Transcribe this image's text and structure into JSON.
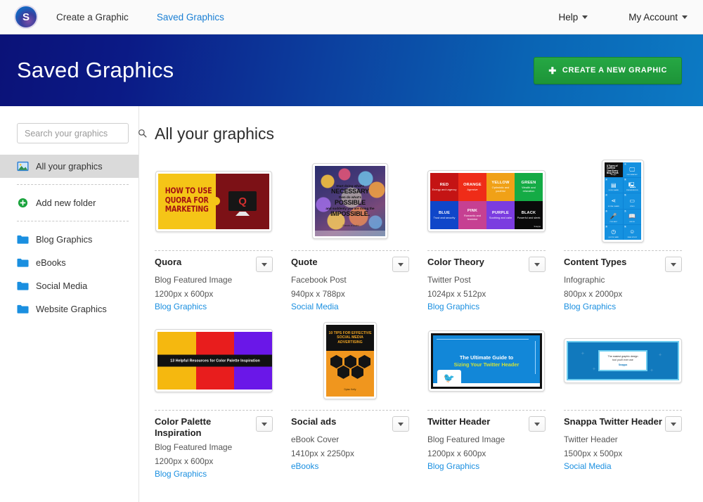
{
  "topnav": {
    "logo_letter": "S",
    "logo_icon": "snappa-logo-icon",
    "links": [
      {
        "label": "Create a Graphic",
        "active": false
      },
      {
        "label": "Saved Graphics",
        "active": true
      }
    ],
    "right_items": [
      {
        "label": "Help"
      },
      {
        "label": "My Account"
      }
    ]
  },
  "hero": {
    "title": "Saved Graphics",
    "button_label": "CREATE A NEW GRAPHIC",
    "button_plus": "✚",
    "button_color": "#1d9438",
    "gradient_from": "#0b1278",
    "gradient_to": "#0c7ac4"
  },
  "sidebar": {
    "search": {
      "placeholder": "Search your graphics",
      "value": "",
      "icon": "search-icon"
    },
    "all_graphics": {
      "label": "All your graphics",
      "icon": "image-icon",
      "selected": true
    },
    "add_folder": {
      "label": "Add new folder",
      "icon": "plus-circle-icon",
      "color": "#19a33c"
    },
    "folders": [
      {
        "label": "Blog Graphics",
        "icon": "folder-icon"
      },
      {
        "label": "eBooks",
        "icon": "folder-icon"
      },
      {
        "label": "Social Media",
        "icon": "folder-icon"
      },
      {
        "label": "Website Graphics",
        "icon": "folder-icon"
      }
    ],
    "folder_color": "#1a8fe0"
  },
  "main": {
    "title": "All your graphics",
    "link_color": "#1a8fe0",
    "cards": [
      {
        "title": "Quora",
        "type": "Blog Featured Image",
        "dimensions": "1200px x 600px",
        "folder": "Blog Graphics",
        "menu_icon": "chevron-down-icon",
        "art": {
          "headline": "HOW TO USE QUORA FOR MARKETING",
          "mark": "Q",
          "left_color": "#f5c517",
          "right_color": "#7c1116"
        }
      },
      {
        "title": "Quote",
        "type": "Facebook Post",
        "dimensions": "940px x 788px",
        "folder": "Social Media",
        "menu_icon": "chevron-down-icon",
        "art": {
          "line1": "Start doing what's",
          "line2": "NECESSARY",
          "line3": "then do what's",
          "line4": "POSSIBLE",
          "line5": "and suddenly you are doing the",
          "line6": "IMPOSSIBLE.",
          "credit": "- Francis of Assisi"
        }
      },
      {
        "title": "Color Theory",
        "type": "Twitter Post",
        "dimensions": "1024px x 512px",
        "folder": "Blog Graphics",
        "menu_icon": "chevron-down-icon",
        "art": {
          "badge": "Snappa",
          "swatches": [
            {
              "name": "RED",
              "desc": "Energy and urgency",
              "color": "#c41414"
            },
            {
              "name": "ORANGE",
              "desc": "Agresive",
              "color": "#ef2c18"
            },
            {
              "name": "YELLOW",
              "desc": "Optimistic and youthful",
              "color": "#f0a117"
            },
            {
              "name": "GREEN",
              "desc": "Wealth and relaxation",
              "color": "#14ab45"
            },
            {
              "name": "BLUE",
              "desc": "Trust and security",
              "color": "#0f46c9"
            },
            {
              "name": "PINK",
              "desc": "Romantic and feminine",
              "color": "#c64092"
            },
            {
              "name": "PURPLE",
              "desc": "Soothing and calm",
              "color": "#7b3ce0"
            },
            {
              "name": "BLACK",
              "desc": "Powerful and sleek",
              "color": "#0a0a0a"
            }
          ]
        }
      },
      {
        "title": "Content Types",
        "type": "Infographic",
        "dimensions": "800px x 2000px",
        "folder": "Blog Graphics",
        "menu_icon": "chevron-down-icon",
        "art": {
          "headline": "8 Types of Content That Every Blog Posts",
          "brand": "Snappa",
          "tiles": [
            {
              "num": "1",
              "glyph": "🖵",
              "label": "INFOGRAPHIC",
              "icon": "monitor-icon"
            },
            {
              "num": "2",
              "glyph": "▤",
              "label": "SLIDE SHARE",
              "icon": "slides-icon"
            },
            {
              "num": "3",
              "glyph": "🖳",
              "label": "PRESENTATION",
              "icon": "presentation-icon"
            },
            {
              "num": "4",
              "glyph": "⋖",
              "label": "SOCIAL SHARE",
              "icon": "share-icon"
            },
            {
              "num": "5",
              "glyph": "▭",
              "label": "VIDEO",
              "icon": "video-icon"
            },
            {
              "num": "6",
              "glyph": "🎤",
              "label": "PODCAST",
              "icon": "microphone-icon"
            },
            {
              "num": "7",
              "glyph": "📖",
              "label": "EBOOK",
              "icon": "book-icon"
            },
            {
              "num": "8",
              "glyph": "◷",
              "label": "QUOTE CARD",
              "icon": "clock-icon"
            },
            {
              "num": "9",
              "glyph": "☺",
              "label": "CASE STUDY",
              "icon": "person-icon"
            }
          ]
        }
      },
      {
        "title": "Color Palette Inspiration",
        "type": "Blog Featured Image",
        "dimensions": "1200px x 600px",
        "folder": "Blog Graphics",
        "menu_icon": "chevron-down-icon",
        "art": {
          "banner": "13 Helpful Resources for Color Palette Inspiration",
          "bands": [
            "#f5b80f",
            "#e81d1d",
            "#6a17e8"
          ]
        }
      },
      {
        "title": "Social ads",
        "type": "eBook Cover",
        "dimensions": "1410px x 2250px",
        "folder": "eBooks",
        "menu_icon": "chevron-down-icon",
        "art": {
          "headline": "10 TIPS FOR EFFECTIVE SOCIAL MEDIA ADVERTISING",
          "author": "Dylan Kelly",
          "bg_color": "#f0961e"
        }
      },
      {
        "title": "Twitter Header",
        "type": "Blog Featured Image",
        "dimensions": "1200px x 600px",
        "folder": "Blog Graphics",
        "menu_icon": "chevron-down-icon",
        "art": {
          "line1": "The Ultimate Guide to",
          "line2": "Sizing Your Twitter Header",
          "bird": "🐦",
          "bg_color": "#1287d8",
          "accent_color": "#cde03a"
        }
      },
      {
        "title": "Snappa Twitter Header",
        "type": "Twitter Header",
        "dimensions": "1500px x 500px",
        "folder": "Social Media",
        "menu_icon": "chevron-down-icon",
        "art": {
          "plate_line1": "The easiest graphic design",
          "plate_line2": "tool you'll ever use",
          "brand": "Snappa",
          "bg_color": "#1179bd"
        }
      }
    ]
  }
}
